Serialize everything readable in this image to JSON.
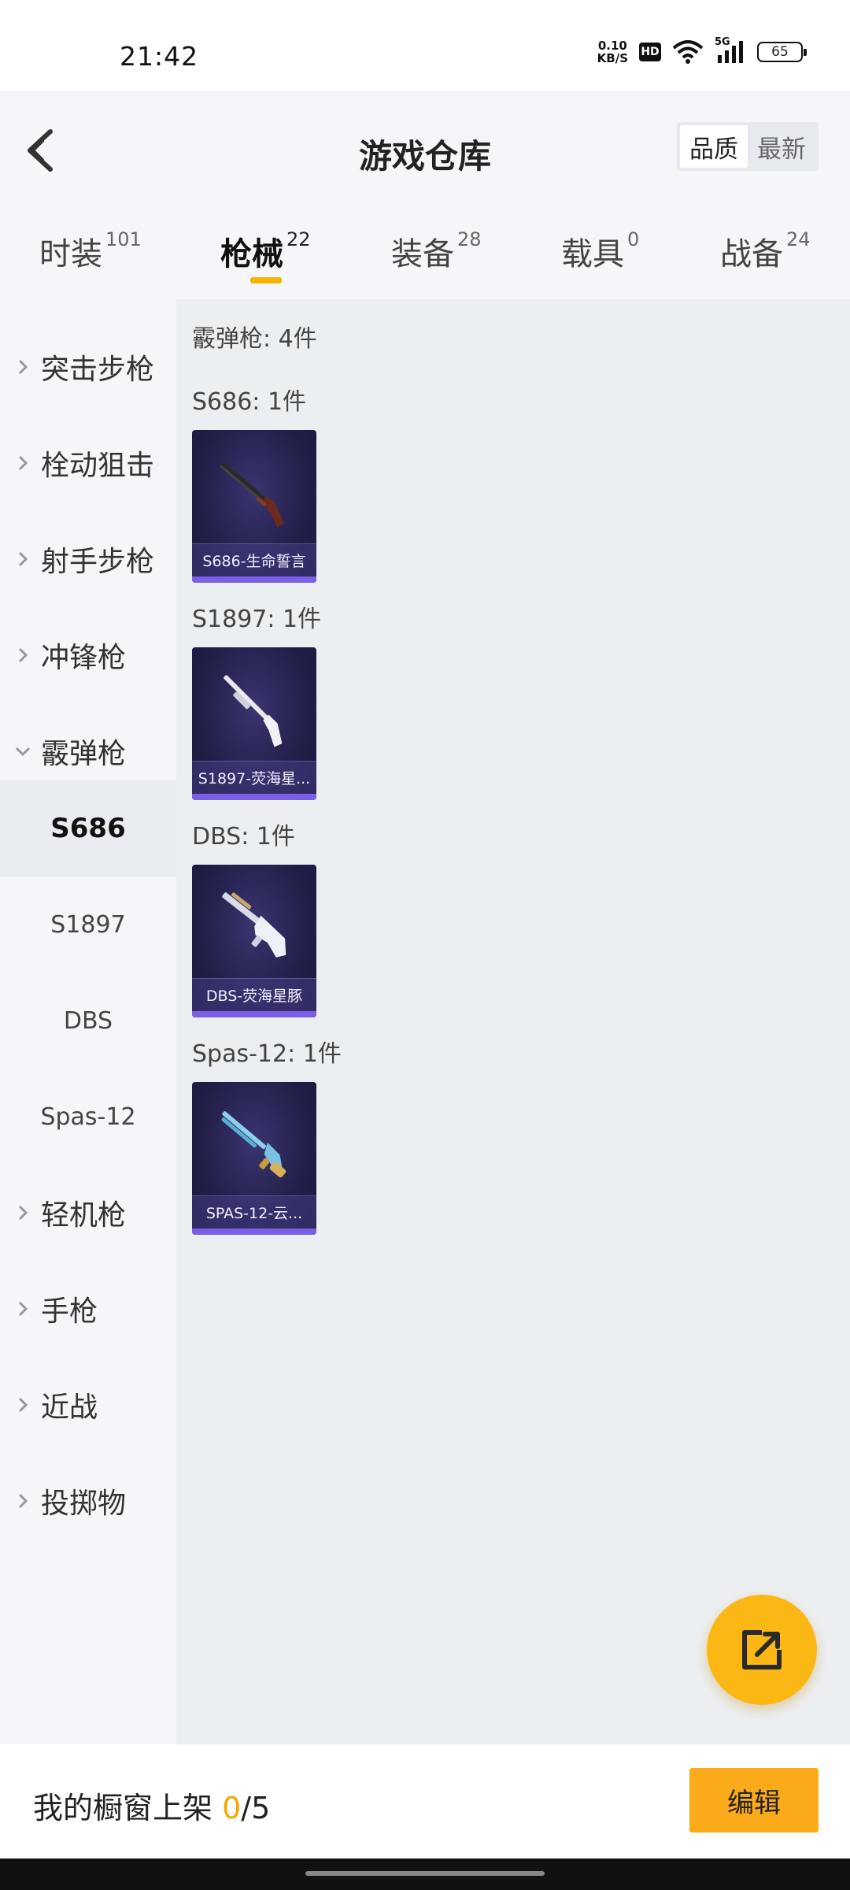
{
  "status_bar": {
    "time": "21:42",
    "net_speed_value": "0.10",
    "net_speed_unit": "KB/S",
    "hd_badge": "HD",
    "signal_label": "5G",
    "battery_level": "65",
    "icons": [
      "wifi-icon",
      "cellular-signal-icon",
      "battery-icon"
    ]
  },
  "header": {
    "title": "游戏仓库",
    "sort_options": [
      "品质",
      "最新"
    ],
    "active_sort": "品质"
  },
  "category_tabs": [
    {
      "label": "时装",
      "count": "101",
      "active": false
    },
    {
      "label": "枪械",
      "count": "22",
      "active": true
    },
    {
      "label": "装备",
      "count": "28",
      "active": false
    },
    {
      "label": "载具",
      "count": "0",
      "active": false
    },
    {
      "label": "战备",
      "count": "24",
      "active": false
    }
  ],
  "sidebar": {
    "categories": [
      {
        "label": "突击步枪",
        "expanded": false
      },
      {
        "label": "栓动狙击",
        "expanded": false
      },
      {
        "label": "射手步枪",
        "expanded": false
      },
      {
        "label": "冲锋枪",
        "expanded": false
      },
      {
        "label": "霰弹枪",
        "expanded": true
      },
      {
        "label": "轻机枪",
        "expanded": false
      },
      {
        "label": "手枪",
        "expanded": false
      },
      {
        "label": "近战",
        "expanded": false
      },
      {
        "label": "投掷物",
        "expanded": false
      }
    ],
    "sub_items": [
      "S686",
      "S1897",
      "DBS",
      "Spas-12"
    ],
    "active_sub_item": "S686"
  },
  "main": {
    "section_title": "霰弹枪: 4件",
    "groups": [
      {
        "title": "S686: 1件",
        "item_name": "S686-生命誓言",
        "weapon_icon": "double-barrel-shotgun-icon"
      },
      {
        "title": "S1897: 1件",
        "item_name": "S1897-荧海星...",
        "weapon_icon": "pump-shotgun-icon"
      },
      {
        "title": "DBS: 1件",
        "item_name": "DBS-荧海星豚",
        "weapon_icon": "bullpup-shotgun-icon"
      },
      {
        "title": "Spas-12: 1件",
        "item_name": "SPAS-12-云...",
        "weapon_icon": "spas-shotgun-icon"
      }
    ]
  },
  "bottom_bar": {
    "shelf_label": "我的橱窗上架 ",
    "shelf_current": "0",
    "shelf_total": "/5",
    "edit_label": "编辑"
  },
  "colors": {
    "accent": "#fbb814",
    "card_bg": "#221f48",
    "rarity_purple": "#7a5fe6"
  }
}
